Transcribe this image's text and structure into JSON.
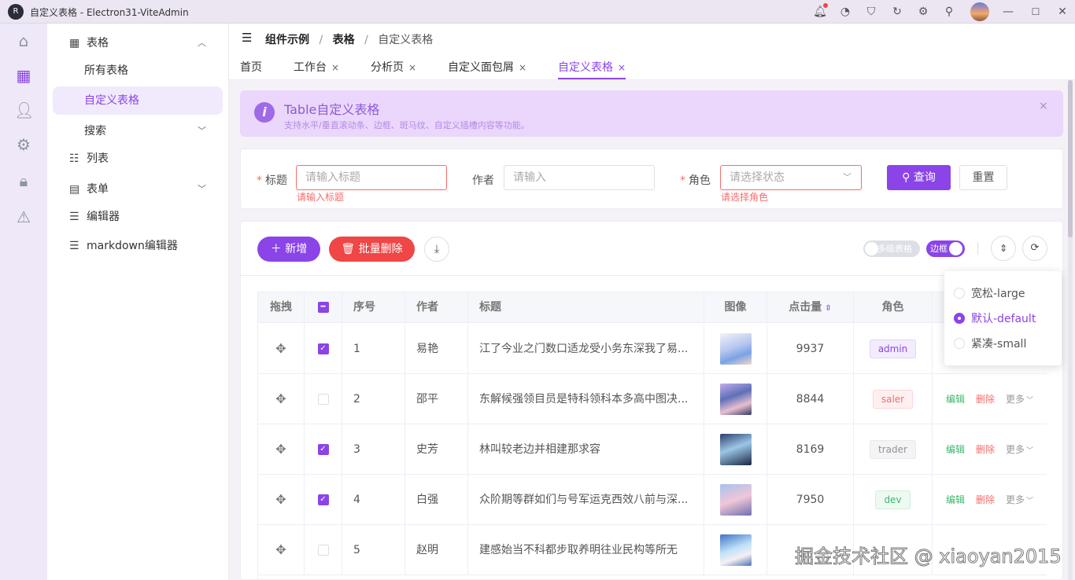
{
  "app": {
    "title": "自定义表格 - Electron31-ViteAdmin",
    "logo_text": "R"
  },
  "titlebar": {
    "icons": [
      "bell-icon",
      "github-icon",
      "shirt-icon",
      "refresh-icon",
      "settings-icon",
      "pin-icon",
      "avatar",
      "minimize-icon",
      "maximize-icon",
      "close-icon"
    ]
  },
  "rail": {
    "icons": [
      "home-icon",
      "dashboard-icon",
      "user-icon",
      "gear-icon",
      "lock-icon",
      "warning-icon"
    ]
  },
  "menu": {
    "table_group": "表格",
    "all_tables": "所有表格",
    "custom_table": "自定义表格",
    "search": "搜索",
    "list": "列表",
    "form": "表单",
    "editor": "编辑器",
    "markdown": "markdown编辑器"
  },
  "breadcrumb": [
    "组件示例",
    "/",
    "表格",
    "/",
    "自定义表格"
  ],
  "tabs": [
    "首页",
    "工作台",
    "分析页",
    "自定义面包屑",
    "自定义表格"
  ],
  "tab_close": "×",
  "alert": {
    "icon": "i",
    "title": "Table自定义表格",
    "desc": "支持水平/垂直滚动条、边框、斑马纹、自定义插槽内容等功能。",
    "close": "×"
  },
  "search": {
    "title_label": "标题",
    "title_placeholder": "请输入标题",
    "title_error": "请输入标题",
    "author_label": "作者",
    "author_placeholder": "请输入",
    "role_label": "角色",
    "role_placeholder": "请选择状态",
    "role_error": "请选择角色",
    "required_mark": "*",
    "query": "查询",
    "reset": "重置"
  },
  "toolbar": {
    "add": "新增",
    "batch_delete": "批量删除",
    "multi_header": "多级表格",
    "border": "边框"
  },
  "table": {
    "headers": [
      "拖拽",
      "",
      "序号",
      "作者",
      "标题",
      "图像",
      "点击量",
      "角色"
    ],
    "rows": [
      {
        "checked": true,
        "index": "1",
        "author": "易艳",
        "title": "江了今业之门数口适龙受小务东深我了易...",
        "clicks": "9937",
        "role": "admin",
        "actions": false
      },
      {
        "checked": false,
        "index": "2",
        "author": "邵平",
        "title": "东解候强领目员是特科领科本多高中图决...",
        "clicks": "8844",
        "role": "saler",
        "actions": true
      },
      {
        "checked": true,
        "index": "3",
        "author": "史芳",
        "title": "林叫较老边并相建那求容",
        "clicks": "8169",
        "role": "trader",
        "actions": true
      },
      {
        "checked": true,
        "index": "4",
        "author": "白强",
        "title": "众阶期等群如们与号军运克西效八前与深...",
        "clicks": "7950",
        "role": "dev",
        "actions": true
      },
      {
        "checked": false,
        "index": "5",
        "author": "赵明",
        "title": "建感始当不科都步取养明往业民构等所无",
        "clicks": "",
        "role": "",
        "actions": false
      }
    ],
    "action_edit": "编辑",
    "action_delete": "删除",
    "action_more": "更多"
  },
  "density": {
    "options": [
      "宽松-large",
      "默认-default",
      "紧凑-small"
    ],
    "selected": "默认-default"
  },
  "watermark": "掘金技术社区 @ xiaoyan2015",
  "colors": {
    "primary": "#8b44e8",
    "danger": "#f04646",
    "success": "#3bb86c"
  }
}
